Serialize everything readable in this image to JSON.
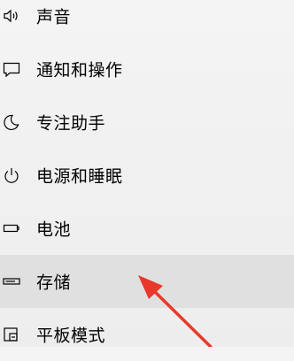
{
  "sidebar": {
    "items": [
      {
        "label": "声音",
        "icon": "speaker-icon"
      },
      {
        "label": "通知和操作",
        "icon": "notification-icon"
      },
      {
        "label": "专注助手",
        "icon": "moon-icon"
      },
      {
        "label": "电源和睡眠",
        "icon": "power-icon"
      },
      {
        "label": "电池",
        "icon": "battery-icon"
      },
      {
        "label": "存储",
        "icon": "storage-drive-icon",
        "selected": true
      },
      {
        "label": "平板模式",
        "icon": "tablet-mode-icon"
      }
    ]
  },
  "colors": {
    "background": "#f2f2f2",
    "selected_background": "#e0e0e0",
    "text": "#000000",
    "annotation_arrow": "#e8392b"
  }
}
